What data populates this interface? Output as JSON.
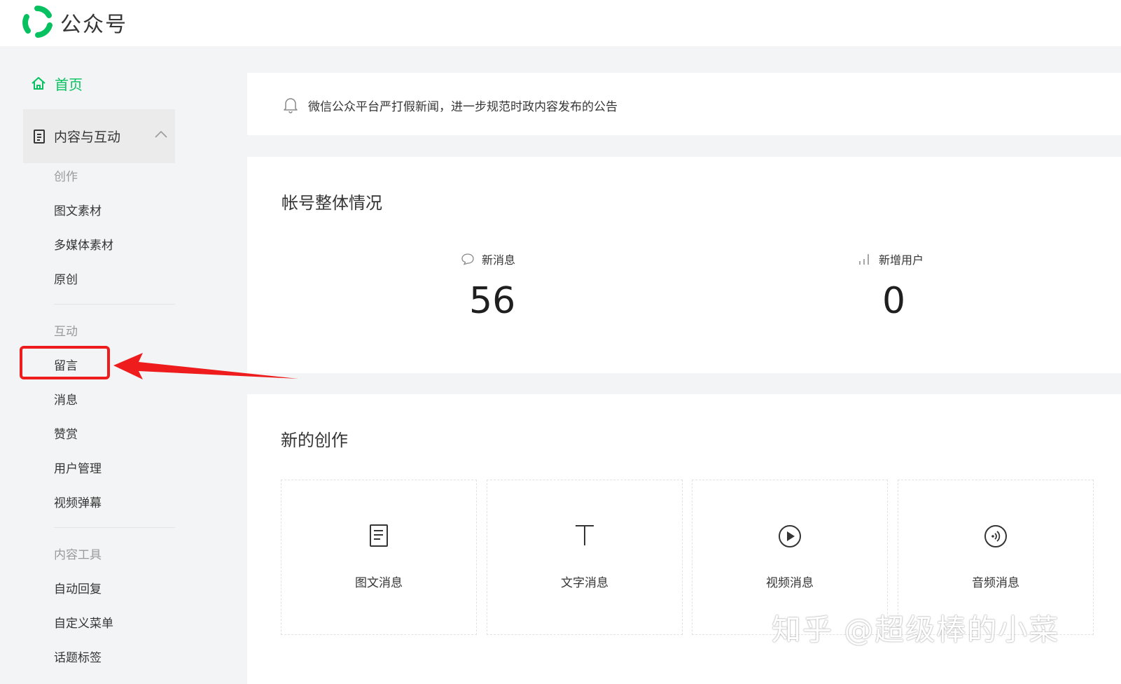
{
  "header": {
    "brand": "公众号",
    "logo_icon": "wechat-mp-logo"
  },
  "colors": {
    "accent": "#07c160",
    "highlight": "#ee1c1c"
  },
  "sidebar": {
    "home": {
      "label": "首页",
      "icon": "home-icon"
    },
    "group": {
      "label": "内容与互动",
      "icon": "document-icon",
      "expanded": true
    },
    "sections": [
      {
        "label": "创作",
        "items": [
          "图文素材",
          "多媒体素材",
          "原创"
        ]
      },
      {
        "label": "互动",
        "items": [
          "留言",
          "消息",
          "赞赏",
          "用户管理",
          "视频弹幕"
        ]
      },
      {
        "label": "内容工具",
        "items": [
          "自动回复",
          "自定义菜单",
          "话题标签"
        ]
      }
    ]
  },
  "notice": {
    "text": "微信公众平台严打假新闻，进一步规范时政内容发布的公告",
    "icon": "bell-icon"
  },
  "overview": {
    "title": "帐号整体情况",
    "stats": [
      {
        "label": "新消息",
        "value": "56",
        "icon": "chat-bubble-icon"
      },
      {
        "label": "新增用户",
        "value": "0",
        "icon": "bar-chart-icon"
      }
    ]
  },
  "creation": {
    "title": "新的创作",
    "tiles": [
      {
        "label": "图文消息",
        "icon": "article-icon"
      },
      {
        "label": "文字消息",
        "icon": "text-icon"
      },
      {
        "label": "视频消息",
        "icon": "play-icon"
      },
      {
        "label": "音频消息",
        "icon": "audio-icon"
      }
    ]
  },
  "watermark": "知乎 @超级棒的小菜"
}
